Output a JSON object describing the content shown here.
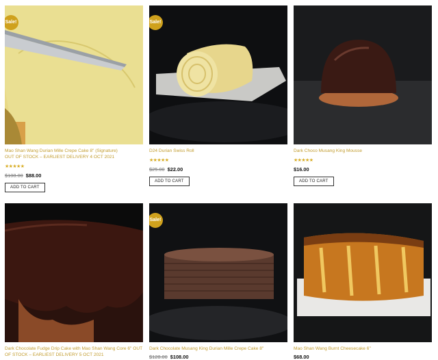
{
  "products": [
    {
      "sale": "Sale!",
      "title": "Mao Shan Wang Durian Mille Crepe Cake 8\" (Signature)",
      "note": "OUT OF STOCK – EARLIEST DELIVERY 4 OCT 2021",
      "stars": "★★★★★",
      "rating": 5,
      "old_price": "$108.00",
      "price": "$88.00",
      "button": "ADD TO CART"
    },
    {
      "sale": "Sale!",
      "title": "D24 Durian Swiss Roll",
      "note": "",
      "stars": "★★★★★",
      "rating": 5,
      "old_price": "$25.00",
      "price": "$22.00",
      "button": "ADD TO CART"
    },
    {
      "sale": "",
      "title": "Dark Choco Musang King Mousse",
      "note": "",
      "stars": "★★★★★",
      "rating": 5,
      "old_price": "",
      "price": "$16.00",
      "button": "ADD TO CART"
    },
    {
      "sale": "",
      "title": "Dark Chocolate Fudge Drip Cake with Mao Shan Wang Core 6\"",
      "note": "OUT OF STOCK – EARLIEST DELIVERY 5 OCT 2021",
      "stars": "",
      "old_price": "",
      "price": "",
      "button": ""
    },
    {
      "sale": "Sale!",
      "title": "Dark Chocolate Musang King Durian Mille Crepe Cake 8\"",
      "note": "",
      "stars": "",
      "old_price": "$128.00",
      "price": "$108.00",
      "button": ""
    },
    {
      "sale": "",
      "title": "Mao Shan Wang Burnt Cheesecake 6\"",
      "note": "",
      "stars": "",
      "old_price": "",
      "price": "$68.00",
      "button": ""
    }
  ]
}
